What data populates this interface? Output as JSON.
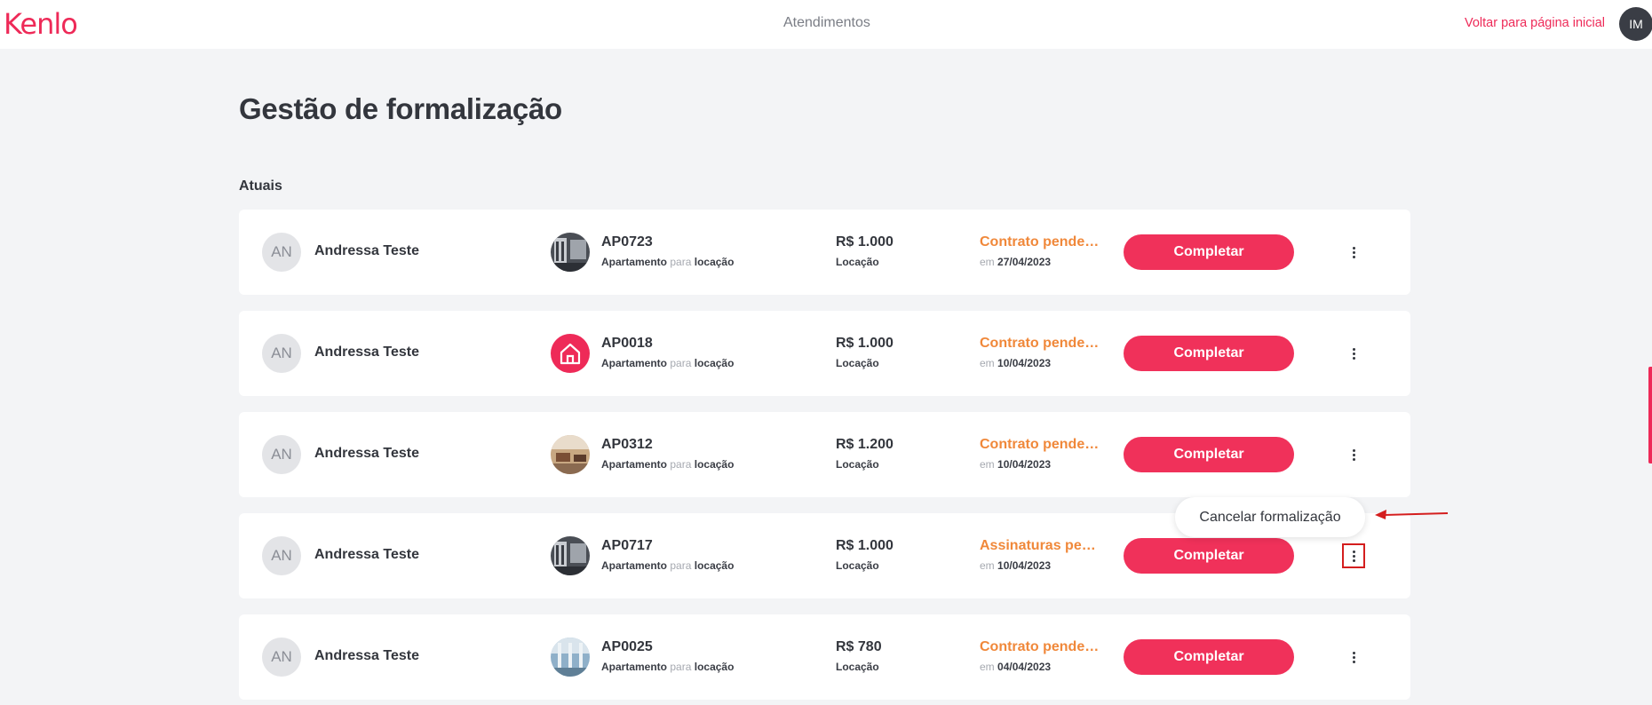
{
  "header": {
    "logo_text": "Kenlo",
    "nav_title": "Atendimentos",
    "back_link": "Voltar para página inicial",
    "user_initials": "IM"
  },
  "page": {
    "title": "Gestão de formalização",
    "section_label": "Atuais"
  },
  "rows": [
    {
      "initials": "AN",
      "name": "Andressa Teste",
      "code": "AP0723",
      "type": "Apartamento",
      "para": "para",
      "purpose": "locação",
      "price": "R$ 1.000",
      "deal": "Locação",
      "status": "Contrato pendente",
      "date_prefix": "em",
      "date": "27/04/2023",
      "button": "Completar",
      "thumb": "photo-dark"
    },
    {
      "initials": "AN",
      "name": "Andressa Teste",
      "code": "AP0018",
      "type": "Apartamento",
      "para": "para",
      "purpose": "locação",
      "price": "R$ 1.000",
      "deal": "Locação",
      "status": "Contrato pendente",
      "date_prefix": "em",
      "date": "10/04/2023",
      "button": "Completar",
      "thumb": "house-icon"
    },
    {
      "initials": "AN",
      "name": "Andressa Teste",
      "code": "AP0312",
      "type": "Apartamento",
      "para": "para",
      "purpose": "locação",
      "price": "R$ 1.200",
      "deal": "Locação",
      "status": "Contrato pendente",
      "date_prefix": "em",
      "date": "10/04/2023",
      "button": "Completar",
      "thumb": "photo-warm"
    },
    {
      "initials": "AN",
      "name": "Andressa Teste",
      "code": "AP0717",
      "type": "Apartamento",
      "para": "para",
      "purpose": "locação",
      "price": "R$ 1.000",
      "deal": "Locação",
      "status": "Assinaturas pendentes",
      "date_prefix": "em",
      "date": "10/04/2023",
      "button": "Completar",
      "thumb": "photo-dark"
    },
    {
      "initials": "AN",
      "name": "Andressa Teste",
      "code": "AP0025",
      "type": "Apartamento",
      "para": "para",
      "purpose": "locação",
      "price": "R$ 780",
      "deal": "Locação",
      "status": "Contrato pendente",
      "date_prefix": "em",
      "date": "04/04/2023",
      "button": "Completar",
      "thumb": "photo-blue"
    }
  ],
  "popup": {
    "label": "Cancelar formalização"
  },
  "colors": {
    "accent": "#ee2a58",
    "status": "#f0883a",
    "highlight_border": "#d41e1e"
  }
}
